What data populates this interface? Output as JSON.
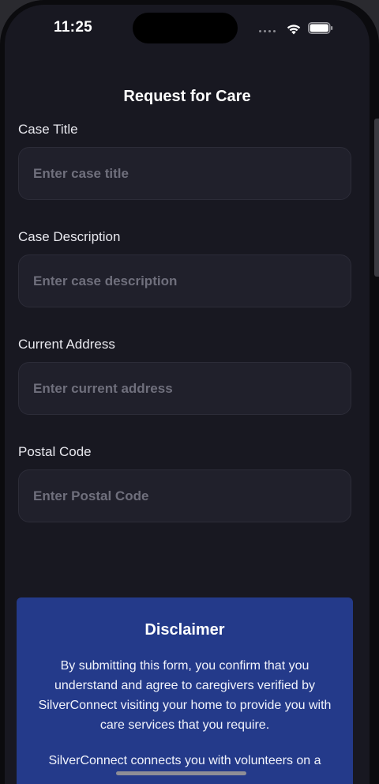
{
  "status_bar": {
    "time": "11:25"
  },
  "header": {
    "title": "Request for Care"
  },
  "form": {
    "fields": [
      {
        "label": "Case Title",
        "placeholder": "Enter case title",
        "value": ""
      },
      {
        "label": "Case Description",
        "placeholder": "Enter case description",
        "value": ""
      },
      {
        "label": "Current Address",
        "placeholder": "Enter current address",
        "value": ""
      },
      {
        "label": "Postal Code",
        "placeholder": "Enter Postal Code",
        "value": ""
      }
    ]
  },
  "disclaimer": {
    "title": "Disclaimer",
    "body": "By submitting this form, you confirm that you understand and agree to caregivers verified by SilverConnect visiting your home to provide you with care services that you require.",
    "more": "SilverConnect connects you with volunteers on a"
  },
  "colors": {
    "background": "#181821",
    "field_background": "#20202b",
    "disclaimer_background": "#243a8a",
    "text_primary": "#ffffff"
  }
}
